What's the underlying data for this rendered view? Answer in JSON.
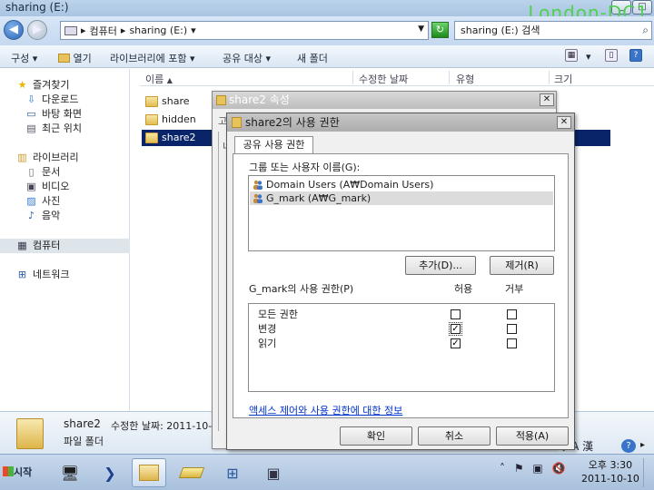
{
  "window": {
    "title": "sharing (E:)",
    "watermark": "London-DC1",
    "controls": {
      "minimize": "_",
      "maximize": "□"
    }
  },
  "address": {
    "back_glyph": "◀",
    "forward_glyph": "▶",
    "segments": [
      "컴퓨터",
      "sharing (E:)"
    ],
    "separator": "▸",
    "search_placeholder": "sharing (E:) 검색"
  },
  "toolbar": {
    "organize": "구성",
    "open": "열기",
    "include_library": "라이브러리에 포함",
    "share_with": "공유 대상",
    "new_folder": "새 폴더",
    "dropdown": "▾"
  },
  "nav": {
    "favorites": "즐겨찾기",
    "downloads": "다운로드",
    "desktop": "바탕 화면",
    "recent": "최근 위치",
    "libraries": "라이브러리",
    "documents": "문서",
    "videos": "비디오",
    "pictures": "사진",
    "music": "음악",
    "computer": "컴퓨터",
    "network": "네트워크"
  },
  "columns": {
    "name": "이름",
    "modified": "수정한 날짜",
    "type": "유형",
    "size": "크기"
  },
  "files": [
    {
      "name": "share"
    },
    {
      "name": "hidden"
    },
    {
      "name": "share2"
    }
  ],
  "details": {
    "name": "share2",
    "modified_label": "수정한 날짜: 2011-10-",
    "type": "파일 폴더"
  },
  "properties_dialog": {
    "title": "share2 속성",
    "close": "✕",
    "peek_a": "고",
    "peek_b": "네"
  },
  "permission_dialog": {
    "title": "share2의 사용 권한",
    "tab": "공유 사용 권한",
    "group_label": "그룹 또는 사용자 이름(G):",
    "users": [
      {
        "name": "Domain Users (A₩Domain Users)",
        "selected": false
      },
      {
        "name": "G_mark (A₩G_mark)",
        "selected": true
      }
    ],
    "add_button": "추가(D)...",
    "remove_button": "제거(R)",
    "perm_label": "G_mark의 사용 권한(P)",
    "allow_col": "허용",
    "deny_col": "거부",
    "permissions": [
      {
        "name": "모든 권한",
        "allow": false,
        "deny": false
      },
      {
        "name": "변경",
        "allow": true,
        "deny": false
      },
      {
        "name": "읽기",
        "allow": true,
        "deny": false
      }
    ],
    "check_glyph": "✓",
    "info_link": "액세스 제어와 사용 권한에 대한 정보",
    "ok_button": "확인",
    "cancel_button": "취소",
    "apply_button": "적용(A)"
  },
  "taskbar": {
    "start": "시작",
    "ime": "A 漢",
    "clock_time": "오후 3:30",
    "clock_date": "2011-10-10"
  },
  "colors": {
    "selection": "#0a246a",
    "link": "#0033cc",
    "watermark": "#4fd24f"
  }
}
